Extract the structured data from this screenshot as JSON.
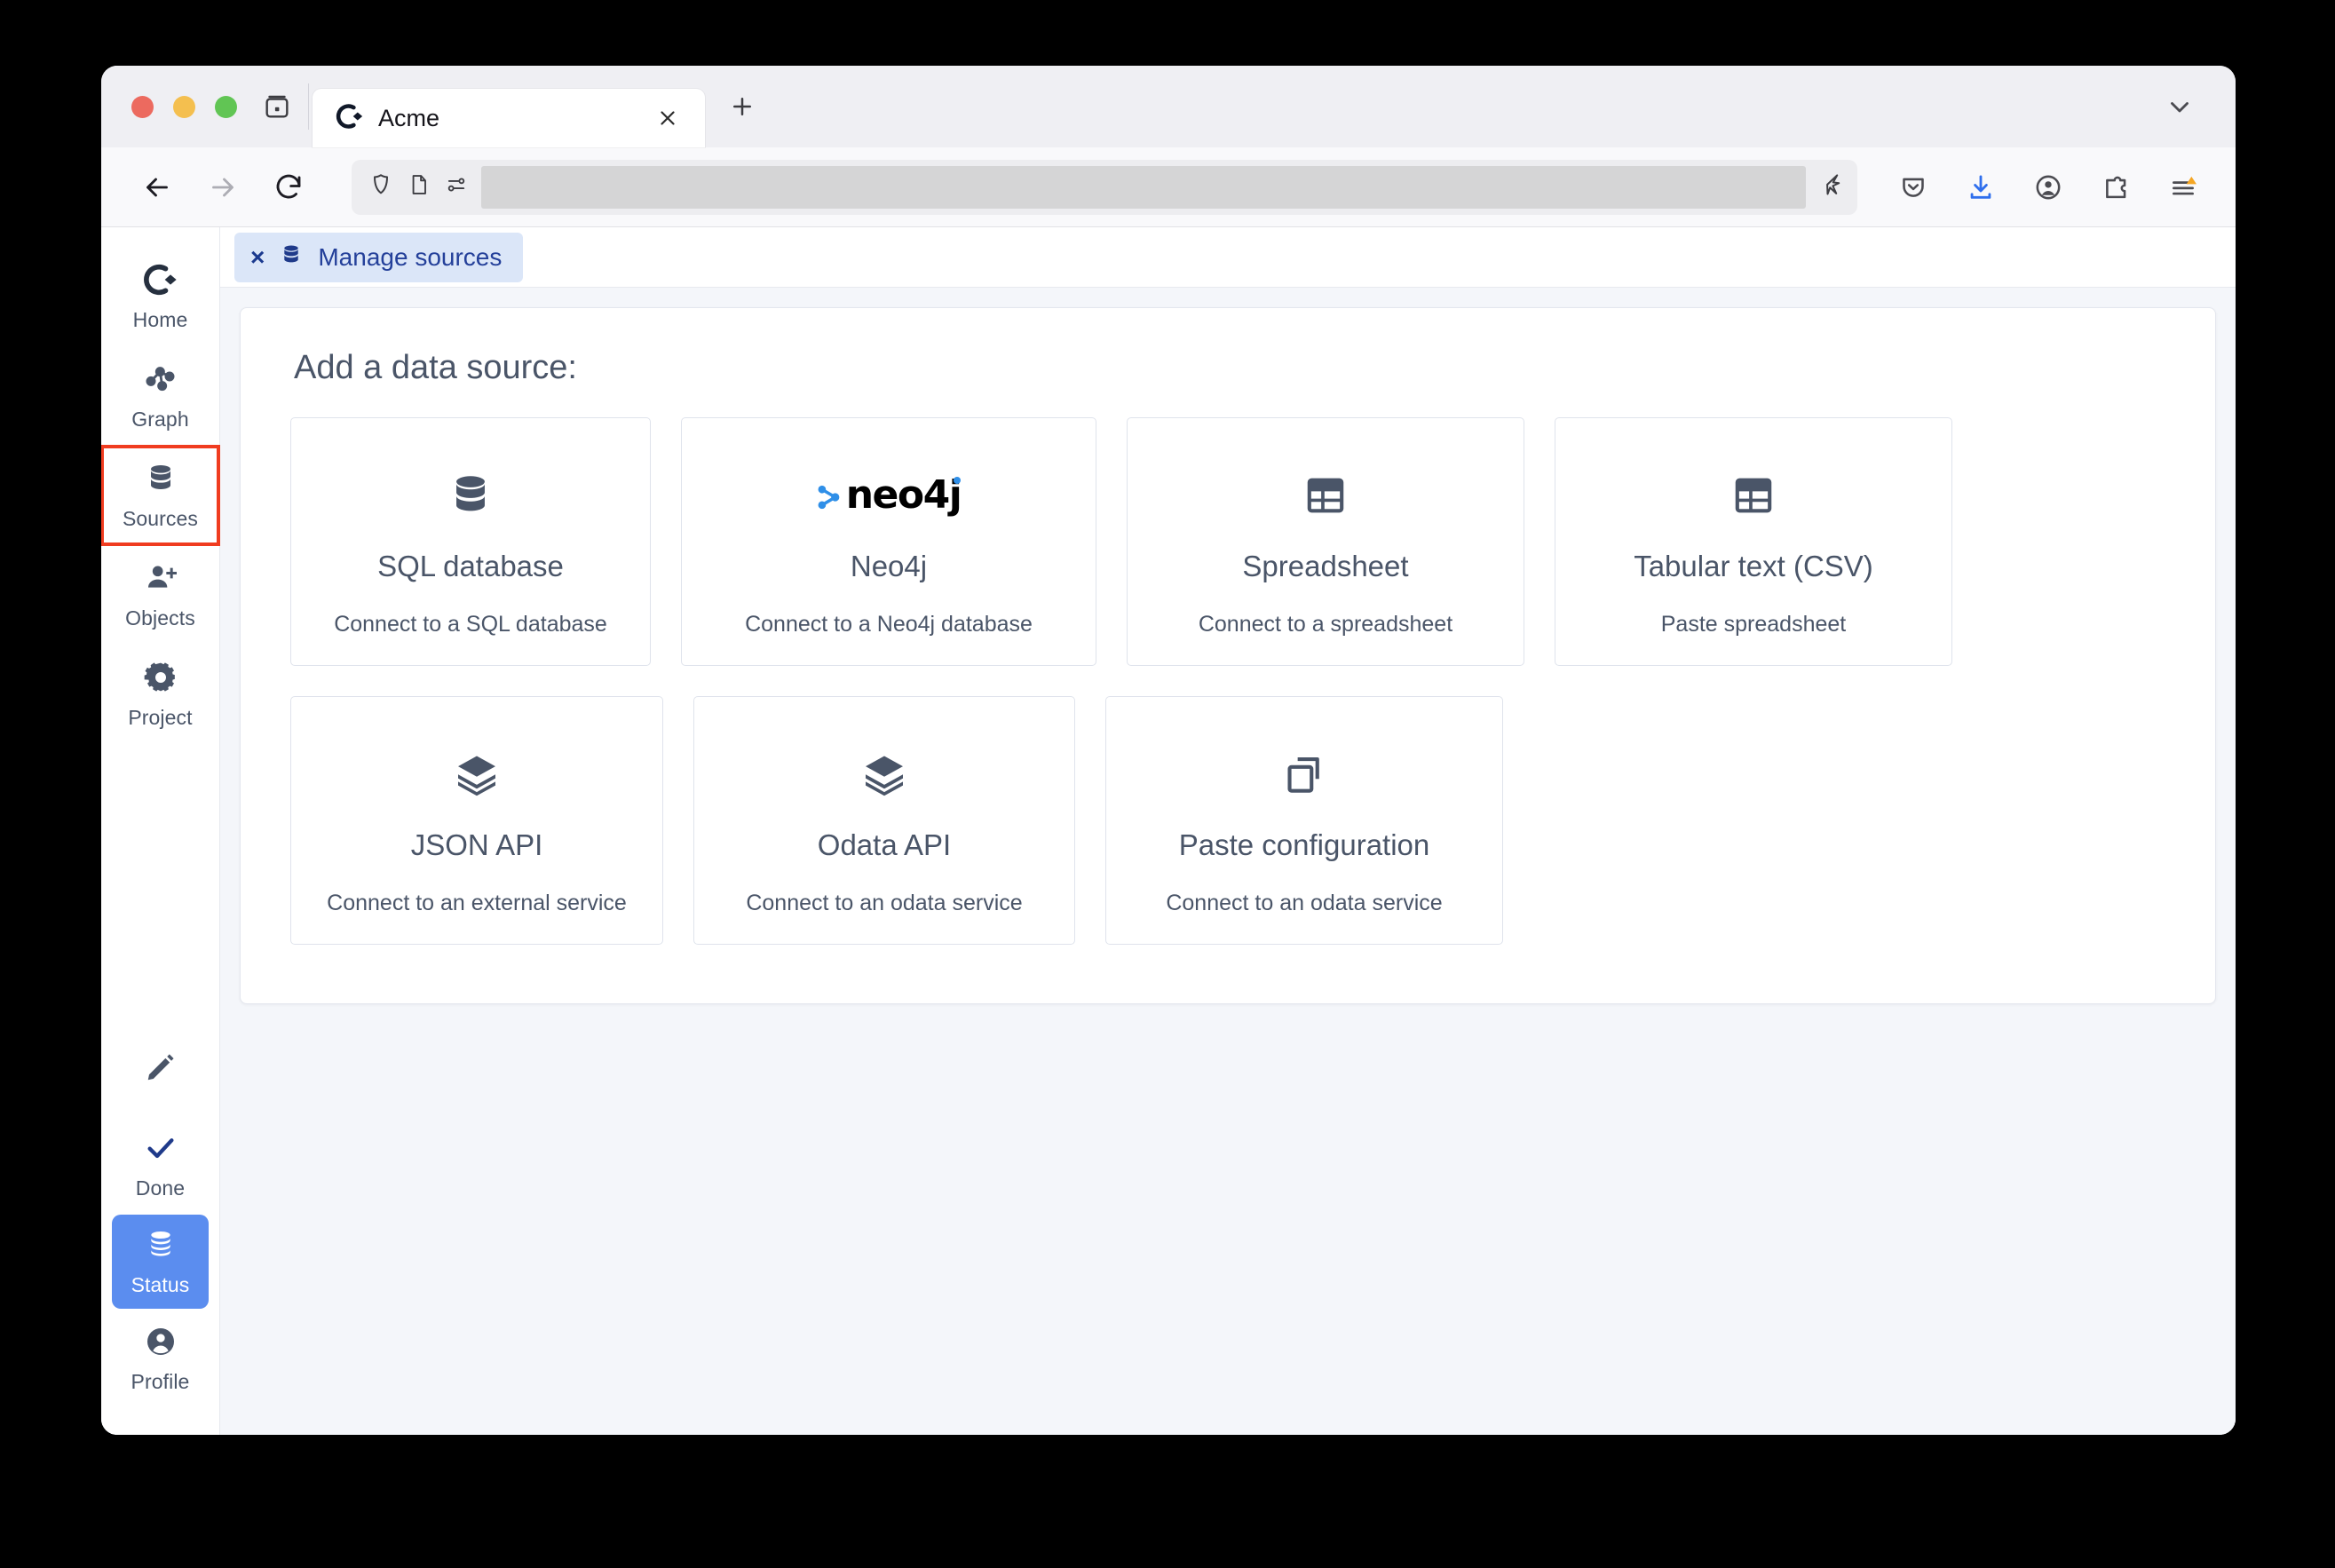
{
  "browser": {
    "tab": {
      "title": "Acme",
      "favicon": "acme-c-diamond-icon",
      "close": "×"
    },
    "new_tab_label": "+",
    "list_all_tabs": "chevron-down-icon",
    "firefox_view": "firefox-view-icon",
    "nav": {
      "back": "back-arrow-icon",
      "forward": "forward-arrow-icon",
      "reload": "reload-icon",
      "shield": "shield-icon",
      "reader": "reader-mode-icon",
      "permissions": "permissions-icon",
      "bookmark": "bookmark-star-icon",
      "url_value": "",
      "url_placeholder": ""
    },
    "toolbar_right": [
      {
        "name": "pocket-icon"
      },
      {
        "name": "downloads-icon"
      },
      {
        "name": "account-icon"
      },
      {
        "name": "extensions-icon"
      },
      {
        "name": "app-menu-icon"
      }
    ]
  },
  "sidebar": {
    "items": [
      {
        "label": "Home",
        "icon": "acme-logo-icon",
        "state": "normal"
      },
      {
        "label": "Graph",
        "icon": "graph-nodes-icon",
        "state": "normal"
      },
      {
        "label": "Sources",
        "icon": "database-icon",
        "state": "highlighted"
      },
      {
        "label": "Objects",
        "icon": "person-add-icon",
        "state": "normal"
      },
      {
        "label": "Project",
        "icon": "gear-icon",
        "state": "normal"
      }
    ],
    "bottom_items": [
      {
        "label": "",
        "icon": "pencil-icon",
        "state": "normal"
      },
      {
        "label": "Done",
        "icon": "check-icon",
        "state": "normal"
      },
      {
        "label": "Status",
        "icon": "database-stack-icon",
        "state": "active"
      },
      {
        "label": "Profile",
        "icon": "account-circle-icon",
        "state": "normal"
      }
    ],
    "highlight_color": "#f03c20",
    "active_color": "#5b8def"
  },
  "workspace": {
    "open_tab": {
      "label": "Manage sources",
      "icon": "database-icon",
      "close": "×"
    },
    "heading": "Add a data source:",
    "sources": [
      {
        "title": "SQL database",
        "subtitle": "Connect to a SQL database",
        "icon": "database-icon"
      },
      {
        "title": "Neo4j",
        "subtitle": "Connect to a Neo4j database",
        "icon": "neo4j-logo-icon",
        "logo_text": "neo4j"
      },
      {
        "title": "Spreadsheet",
        "subtitle": "Connect to a spreadsheet",
        "icon": "table-icon"
      },
      {
        "title": "Tabular text (CSV)",
        "subtitle": "Paste spreadsheet",
        "icon": "table-icon"
      },
      {
        "title": "JSON API",
        "subtitle": "Connect to an external service",
        "icon": "layers-icon"
      },
      {
        "title": "Odata API",
        "subtitle": "Connect to an odata service",
        "icon": "layers-icon"
      },
      {
        "title": "Paste configuration",
        "subtitle": "Connect to an odata service",
        "icon": "copy-icon"
      }
    ]
  }
}
